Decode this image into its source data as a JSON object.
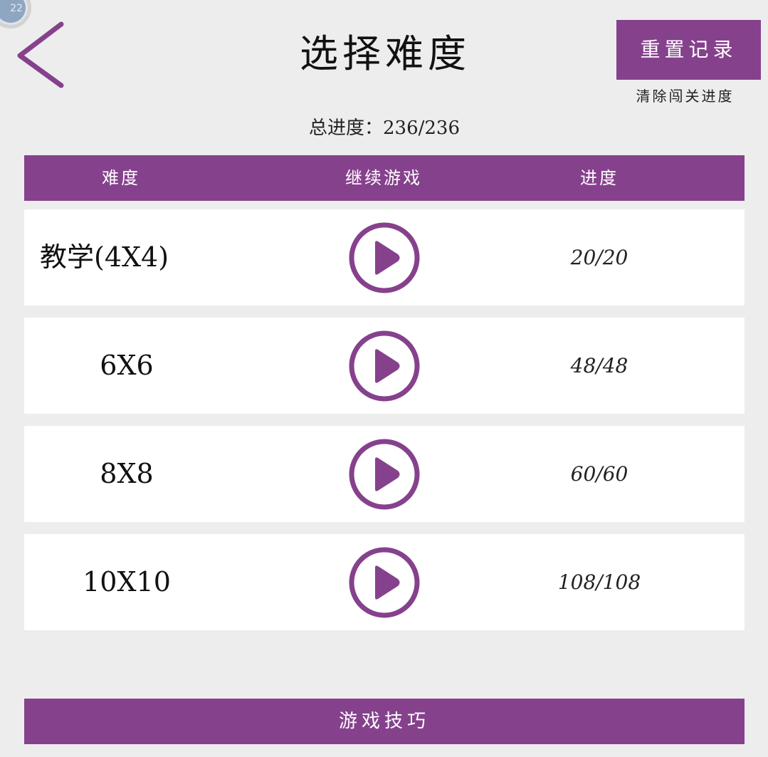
{
  "badge": {
    "text": "22"
  },
  "header": {
    "title": "选择难度",
    "reset_button": "重置记录",
    "reset_subtitle": "清除闯关进度",
    "total_progress": "总进度：236/236"
  },
  "table": {
    "columns": [
      "难度",
      "继续游戏",
      "进度"
    ],
    "rows": [
      {
        "level": "教学(4X4)",
        "progress": "20/20"
      },
      {
        "level": "6X6",
        "progress": "48/48"
      },
      {
        "level": "8X8",
        "progress": "60/60"
      },
      {
        "level": "10X10",
        "progress": "108/108"
      }
    ]
  },
  "footer": {
    "tips_button": "游戏技巧"
  },
  "colors": {
    "accent": "#86418d",
    "background": "#ededed",
    "row_background": "#ffffff"
  },
  "icons": {
    "back": "chevron-left-icon",
    "play": "play-circle-icon"
  }
}
